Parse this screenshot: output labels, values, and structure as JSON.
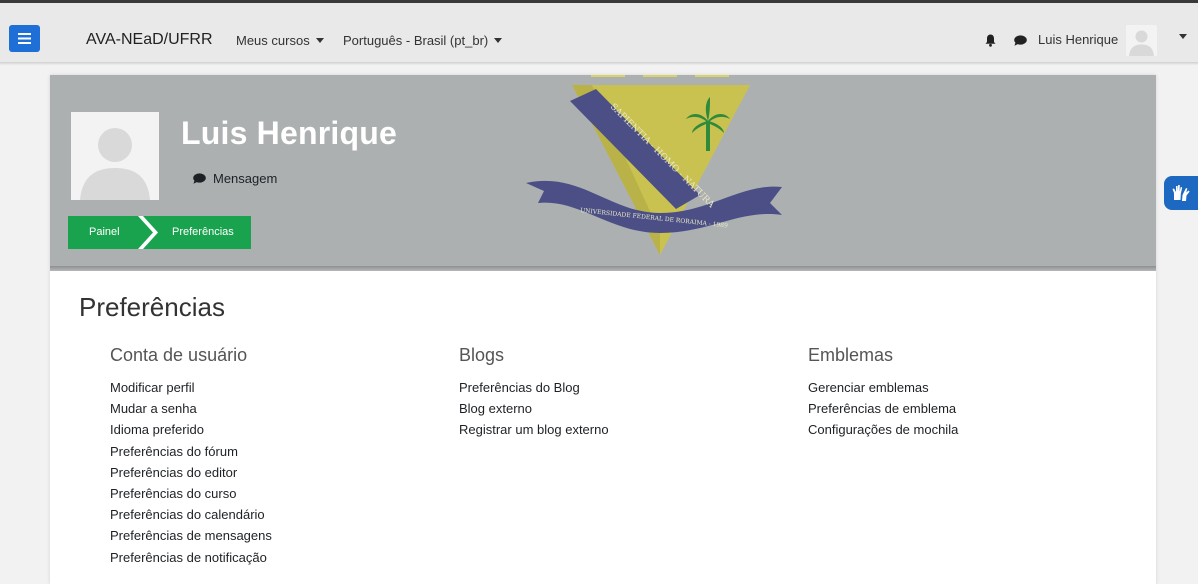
{
  "navbar": {
    "site_name": "AVA-NEaD/UFRR",
    "menus": [
      "Meus cursos",
      "Português - Brasil (pt_br)"
    ],
    "user_name": "Luis Henrique"
  },
  "profile": {
    "name": "Luis Henrique",
    "message_label": "Mensagem"
  },
  "breadcrumb": [
    "Painel",
    "Preferências"
  ],
  "page": {
    "title": "Preferências",
    "columns": [
      {
        "heading": "Conta de usuário",
        "links": [
          "Modificar perfil",
          "Mudar a senha",
          "Idioma preferido",
          "Preferências do fórum",
          "Preferências do editor",
          "Preferências do curso",
          "Preferências do calendário",
          "Preferências de mensagens",
          "Preferências de notificação"
        ]
      },
      {
        "heading": "Blogs",
        "links": [
          "Preferências do Blog",
          "Blog externo",
          "Registrar um blog externo"
        ]
      },
      {
        "heading": "Emblemas",
        "links": [
          "Gerenciar emblemas",
          "Preferências de emblema",
          "Configurações de mochila"
        ]
      }
    ]
  },
  "emblem_text": {
    "motto": "SAPIENTIA - HOMO - NATURA",
    "ribbon": "UNIVERSIDADE FEDERAL DE RORAIMA - 1989"
  },
  "colors": {
    "primary": "#1e6fd6",
    "breadcrumb": "#1aa34e",
    "header_band": "#adb0b1"
  },
  "icons": [
    "hamburger-icon",
    "bell-icon",
    "chat-icon",
    "user-avatar-icon",
    "accessibility-hands-icon"
  ]
}
